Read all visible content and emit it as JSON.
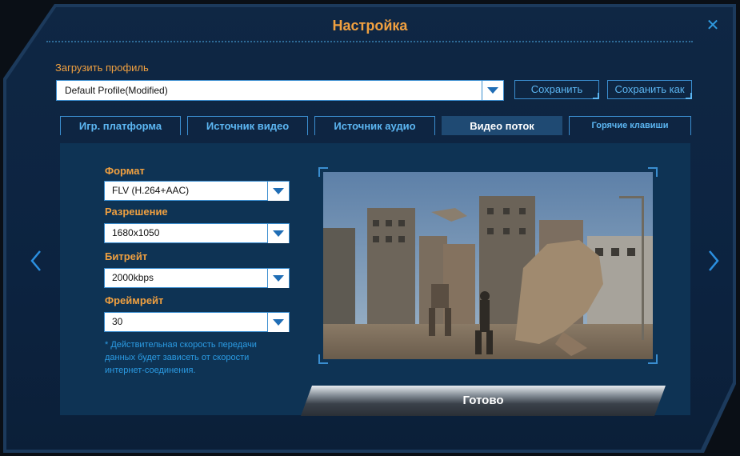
{
  "dialog": {
    "title": "Настройка",
    "close_symbol": "✕"
  },
  "profile": {
    "label": "Загрузить профиль",
    "selected": "Default Profile(Modified)",
    "save_label": "Сохранить",
    "save_as_label": "Сохранить как"
  },
  "tabs": [
    {
      "label": "Игр. платформа"
    },
    {
      "label": "Источник видео"
    },
    {
      "label": "Источник аудио"
    },
    {
      "label": "Видео поток"
    },
    {
      "label": "Горячие клавиши"
    }
  ],
  "active_tab": "Видео поток",
  "settings": {
    "format_label": "Формат",
    "format_value": "FLV (H.264+AAC)",
    "resolution_label": "Разрешение",
    "resolution_value": "1680x1050",
    "bitrate_label": "Битрейт",
    "bitrate_value": "2000kbps",
    "framerate_label": "Фреймрейт",
    "framerate_value": "30",
    "note": "* Действительная скорость передачи данных будет зависеть от скорости интернет-соединения."
  },
  "done_label": "Готово",
  "colors": {
    "accent_orange": "#f0a040",
    "accent_blue": "#2b9be3",
    "panel_bg": "#0e3354",
    "active_tab_bg": "#1f4a73"
  },
  "icons": {
    "close": "close-icon",
    "dropdown": "chevron-down-icon",
    "prev": "chevron-left-icon",
    "next": "chevron-right-icon"
  }
}
